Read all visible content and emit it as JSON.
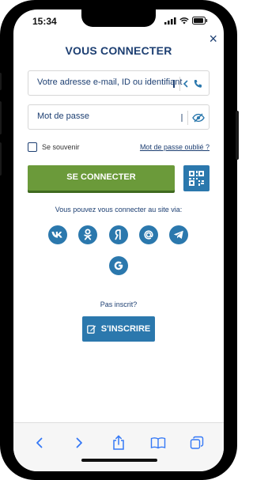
{
  "status_bar": {
    "time": "15:34"
  },
  "modal": {
    "title": "VOUS CONNECTER",
    "close_label": "×"
  },
  "login_field": {
    "placeholder": "Votre adresse e-mail, ID ou identifiant"
  },
  "password_field": {
    "placeholder": "Mot de passe"
  },
  "remember": {
    "label": "Se souvenir",
    "checked": false
  },
  "forgot_link": "Mot de passe oublié ?",
  "login_button": "SE CONNECTER",
  "social": {
    "prompt": "Vous pouvez vous connecter au site via:",
    "providers": [
      "vk",
      "odnoklassniki",
      "yandex",
      "mail-ru",
      "telegram",
      "google"
    ]
  },
  "register": {
    "prompt": "Pas inscrit?",
    "button": "S'INSCRIRE"
  },
  "colors": {
    "brand_navy": "#1d3f72",
    "brand_blue": "#2b78ad",
    "login_green": "#6b9a3a",
    "ios_toolbar_blue": "#3478f6"
  },
  "browser_toolbar": {
    "icons": [
      "back-icon",
      "forward-icon",
      "share-icon",
      "bookmarks-icon",
      "tabs-icon"
    ]
  }
}
